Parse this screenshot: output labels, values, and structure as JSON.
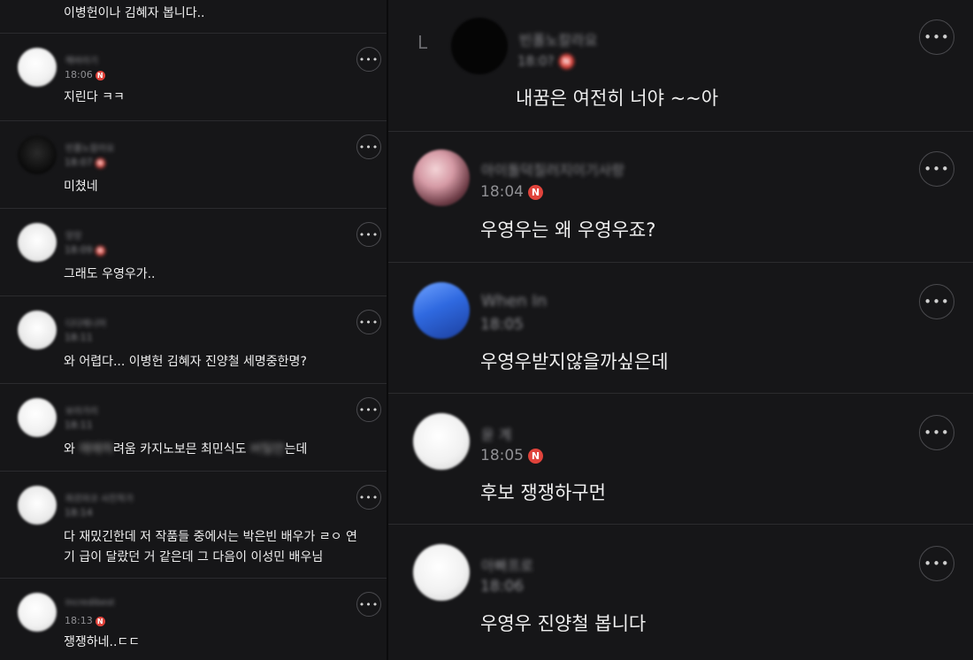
{
  "left": {
    "top_text": "이병헌이나 김혜자 봅니다..",
    "comments": [
      {
        "author": "해바라기",
        "time": "18:06",
        "text": "지린다 ㅋㅋ"
      },
      {
        "author": "빈폴노칼라요",
        "time": "18:07",
        "text": "미쳤네"
      },
      {
        "author": "앙앙",
        "time": "18:09",
        "text": "그래도 우영우가.."
      },
      {
        "author": "디다제니어",
        "time": "18:11",
        "text": "와 어렵다... 이병헌 김혜자 진양철 세명중한명?"
      },
      {
        "author": "보라가리",
        "time": "18:11",
        "text_pre": "와 ",
        "text_blur1": "애매하",
        "text_mid": "려움 카지노보믄 최민식도 ",
        "text_blur2": "버틸만",
        "text_post": "는데"
      },
      {
        "author": "파르마코 사진작가",
        "time": "18:14",
        "text_line1": "다 재밌긴한데 저 작품들 중에서는 박은빈 배우가 ㄹㅇ 연",
        "text_line2": "기 급이 달랐던 거 같은데 그 다음이 이성민 배우님"
      },
      {
        "author": "Incredibest",
        "time": "18:13",
        "text": "쟁쟁하네..ㄷㄷ"
      }
    ]
  },
  "right": {
    "comments": [
      {
        "author": "빈폴노칼라요",
        "time": "18:0?",
        "text": "내꿈은 여전히 너야 ~~아"
      },
      {
        "author": "아이돌덕질러지이기사랑",
        "time": "18:04",
        "text": "우영우는 왜 우영우죠?"
      },
      {
        "author": "When In",
        "time": "18:05",
        "text": "우영우받지않을까싶은데"
      },
      {
        "author": "윤 계",
        "time": "18:05",
        "text": "후보 쟁쟁하구먼"
      },
      {
        "author": "아빠프로",
        "time": "18:06",
        "text": "우영우 진양철 봅니다"
      }
    ]
  },
  "icons": {
    "more": "•••",
    "badge": "N",
    "reply": "L"
  }
}
